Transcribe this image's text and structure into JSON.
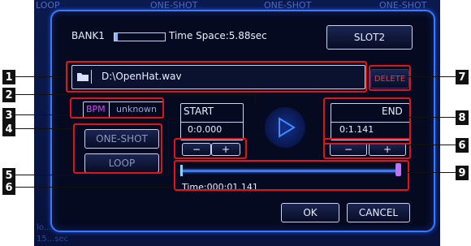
{
  "background": {
    "header_tabs": [
      "LOOP",
      "ONE-SHOT",
      "ONE-SHOT",
      "ONE-SHOT"
    ],
    "footer_text": [
      "lo...",
      "15...sec"
    ]
  },
  "dialog": {
    "bank_label": "BANK1",
    "time_space": "Time Space:5.88sec",
    "slot_button": "SLOT2",
    "file_path": "D:\\OpenHat.wav",
    "delete_button": "DELETE",
    "bpm_label": "BPM",
    "bpm_value": "unknown",
    "mode_oneshot": "ONE-SHOT",
    "mode_loop": "LOOP",
    "start_label": "START",
    "start_value": "0:0.000",
    "end_label": "END",
    "end_value": "0:1.141",
    "minus": "−",
    "plus": "+",
    "time_readout": "Time:000:01.141",
    "ok_button": "OK",
    "cancel_button": "CANCEL"
  },
  "callouts": [
    "1",
    "2",
    "3",
    "4",
    "5",
    "6",
    "7",
    "8",
    "6",
    "9"
  ],
  "colors": {
    "highlight": "#e0141c",
    "accent": "#3a78ff",
    "bpm": "#e040ff",
    "dialog_bg": "#050a20"
  },
  "icons": [
    "folder-icon",
    "play-icon"
  ]
}
